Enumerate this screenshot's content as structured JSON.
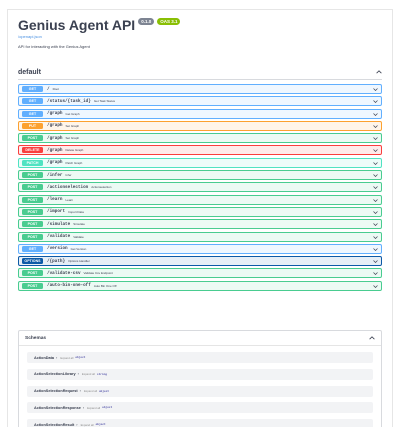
{
  "header": {
    "title": "Genius Agent API",
    "version_badge": "0.1.0",
    "oas_badge": "OAS 3.1",
    "openapi_link": "/openapi.json",
    "description": "API for interacting with the Genius Agent"
  },
  "tag": {
    "name": "default"
  },
  "method_colors": {
    "GET": "#61affe",
    "POST": "#49cc90",
    "PUT": "#fca130",
    "DELETE": "#f93e3e",
    "PATCH": "#50e3c2",
    "OPTIONS": "#0d5aa7"
  },
  "operations": [
    {
      "method": "GET",
      "path": "/",
      "summary": "Root"
    },
    {
      "method": "GET",
      "path": "/status/{task_id}",
      "summary": "Get Task Status"
    },
    {
      "method": "GET",
      "path": "/graph",
      "summary": "Get Graph"
    },
    {
      "method": "PUT",
      "path": "/graph",
      "summary": "Set Graph"
    },
    {
      "method": "POST",
      "path": "/graph",
      "summary": "Set Graph"
    },
    {
      "method": "DELETE",
      "path": "/graph",
      "summary": "Delete Graph"
    },
    {
      "method": "PATCH",
      "path": "/graph",
      "summary": "Patch Graph"
    },
    {
      "method": "POST",
      "path": "/infer",
      "summary": "Infer"
    },
    {
      "method": "POST",
      "path": "/actionselection",
      "summary": "Actionselection"
    },
    {
      "method": "POST",
      "path": "/learn",
      "summary": "Learn"
    },
    {
      "method": "POST",
      "path": "/import",
      "summary": "Import Data"
    },
    {
      "method": "POST",
      "path": "/simulate",
      "summary": "Simulate"
    },
    {
      "method": "POST",
      "path": "/validate",
      "summary": "Validate"
    },
    {
      "method": "GET",
      "path": "/version",
      "summary": "Get Version"
    },
    {
      "method": "OPTIONS",
      "path": "/{path}",
      "summary": "Options Handler"
    },
    {
      "method": "POST",
      "path": "/validate-csv",
      "summary": "Validate Csv Endpoint"
    },
    {
      "method": "POST",
      "path": "/auto-bin-one-off",
      "summary": "Auto Bin One Off"
    }
  ],
  "schemas": {
    "title": "Schemas",
    "expand_label": "Expand all",
    "items": [
      {
        "name": "ActionData",
        "type": "object"
      },
      {
        "name": "ActionSelectionLibrary",
        "type": "string"
      },
      {
        "name": "ActionSelectionRequest",
        "type": "object"
      },
      {
        "name": "ActionSelectionResponse",
        "type": "object"
      },
      {
        "name": "ActionSelectionResult",
        "type": "object"
      }
    ]
  }
}
